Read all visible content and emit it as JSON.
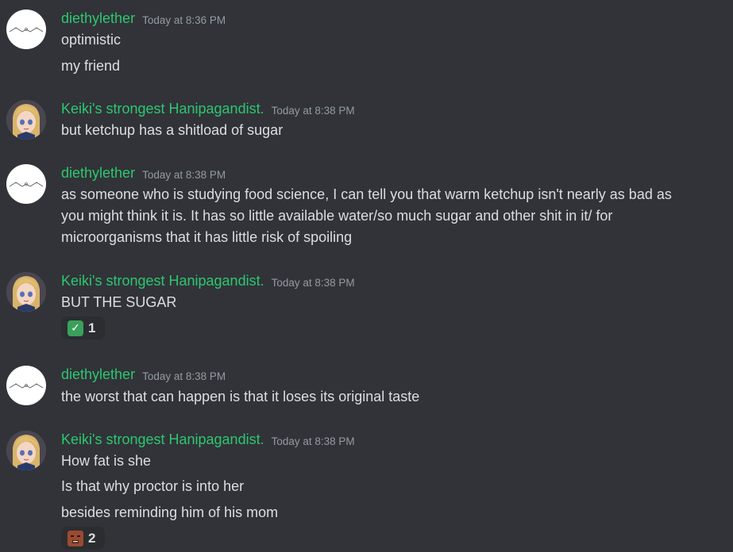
{
  "messages": [
    {
      "username": "diethylether",
      "timestamp": "Today at 8:36 PM",
      "avatar": "ether-molecule-avatar",
      "lines": [
        "optimistic",
        "my friend"
      ]
    },
    {
      "username": "Keiki's strongest Hanipagandist.",
      "timestamp": "Today at 8:38 PM",
      "avatar": "anime-girl-avatar",
      "lines": [
        "but ketchup has a shitload of sugar"
      ]
    },
    {
      "username": "diethylether",
      "timestamp": "Today at 8:38 PM",
      "avatar": "ether-molecule-avatar",
      "lines": [
        "as someone who is studying food science, I can tell you that warm ketchup isn't nearly as bad as",
        "you might think it is. It has so little available water/so much sugar and other shit in it/  for",
        "microorganisms that it has little risk of spoiling"
      ]
    },
    {
      "username": "Keiki's strongest Hanipagandist.",
      "timestamp": "Today at 8:38 PM",
      "avatar": "anime-girl-avatar",
      "lines": [
        "BUT THE SUGAR"
      ],
      "reaction": {
        "emoji": "check-mark-emoji",
        "count": "1"
      }
    },
    {
      "username": "diethylether",
      "timestamp": "Today at 8:38 PM",
      "avatar": "ether-molecule-avatar",
      "lines": [
        "the worst that can happen is that it loses its original taste"
      ]
    },
    {
      "username": "Keiki's strongest Hanipagandist.",
      "timestamp": "Today at 8:38 PM",
      "avatar": "anime-girl-avatar",
      "lines": [
        "How fat is she",
        "Is that why proctor is into her",
        "besides reminding him of his mom"
      ],
      "reaction": {
        "emoji": "face-emoji",
        "count": "2"
      }
    }
  ],
  "colors": {
    "background": "#313338",
    "username": "#2dc770",
    "timestamp": "#949ba4",
    "text": "#dbdee1",
    "reaction_bg": "#2b2d31"
  }
}
